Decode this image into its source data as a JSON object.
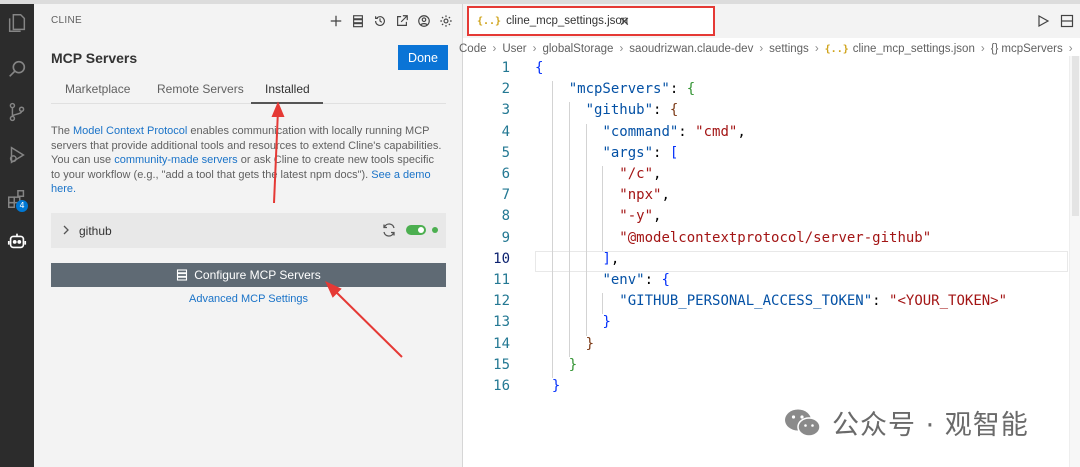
{
  "activity_bar": {
    "extensions_badge": "4",
    "icons": [
      "files-icon",
      "search-icon",
      "source-control-icon",
      "run-debug-icon",
      "extensions-icon",
      "cline-robot-icon"
    ]
  },
  "cline_panel": {
    "title": "CLINE",
    "heading": "MCP Servers",
    "done_label": "Done",
    "tabs": [
      {
        "label": "Marketplace",
        "active": false
      },
      {
        "label": "Remote Servers",
        "active": false
      },
      {
        "label": "Installed",
        "active": true
      }
    ],
    "description": {
      "t1": "The ",
      "link1": "Model Context Protocol",
      "t2": " enables communication with locally running MCP servers that provide additional tools and resources to extend Cline's capabilities. You can use ",
      "link2": "community-made servers",
      "t3": " or ask Cline to create new tools specific to your workflow (e.g., \"add a tool that gets the latest npm docs\"). ",
      "link3": "See a demo here."
    },
    "server": {
      "name": "github",
      "enabled": true,
      "status_color": "#4caf50"
    },
    "configure_label": "Configure MCP Servers",
    "advanced_label": "Advanced MCP Settings"
  },
  "editor": {
    "tab_label": "cline_mcp_settings.json",
    "tab_icon": "{..}",
    "breadcrumb": [
      "Code",
      "User",
      "globalStorage",
      "saoudrizwan.claude-dev",
      "settings",
      "cline_mcp_settings.json",
      "mcpServers",
      "gi"
    ],
    "breadcrumb_icons": {
      "json_file": "{..}",
      "object": "{}"
    },
    "current_line": 10,
    "lines": [
      {
        "n": "1",
        "tokens": [
          {
            "t": "{",
            "c": "b1"
          }
        ]
      },
      {
        "n": "2",
        "tokens": [
          {
            "t": "    ",
            "c": "p"
          },
          {
            "t": "\"mcpServers\"",
            "c": "k"
          },
          {
            "t": ": ",
            "c": "p"
          },
          {
            "t": "{",
            "c": "b2"
          }
        ]
      },
      {
        "n": "3",
        "tokens": [
          {
            "t": "      ",
            "c": "p"
          },
          {
            "t": "\"github\"",
            "c": "k"
          },
          {
            "t": ": ",
            "c": "p"
          },
          {
            "t": "{",
            "c": "b3"
          }
        ]
      },
      {
        "n": "4",
        "tokens": [
          {
            "t": "        ",
            "c": "p"
          },
          {
            "t": "\"command\"",
            "c": "k"
          },
          {
            "t": ": ",
            "c": "p"
          },
          {
            "t": "\"cmd\"",
            "c": "s"
          },
          {
            "t": ",",
            "c": "p"
          }
        ]
      },
      {
        "n": "5",
        "tokens": [
          {
            "t": "        ",
            "c": "p"
          },
          {
            "t": "\"args\"",
            "c": "k"
          },
          {
            "t": ": ",
            "c": "p"
          },
          {
            "t": "[",
            "c": "b1"
          }
        ]
      },
      {
        "n": "6",
        "tokens": [
          {
            "t": "          ",
            "c": "p"
          },
          {
            "t": "\"/c\"",
            "c": "s"
          },
          {
            "t": ",",
            "c": "p"
          }
        ]
      },
      {
        "n": "7",
        "tokens": [
          {
            "t": "          ",
            "c": "p"
          },
          {
            "t": "\"npx\"",
            "c": "s"
          },
          {
            "t": ",",
            "c": "p"
          }
        ]
      },
      {
        "n": "8",
        "tokens": [
          {
            "t": "          ",
            "c": "p"
          },
          {
            "t": "\"-y\"",
            "c": "s"
          },
          {
            "t": ",",
            "c": "p"
          }
        ]
      },
      {
        "n": "9",
        "tokens": [
          {
            "t": "          ",
            "c": "p"
          },
          {
            "t": "\"@modelcontextprotocol/server-github\"",
            "c": "s"
          }
        ]
      },
      {
        "n": "10",
        "tokens": [
          {
            "t": "        ",
            "c": "p"
          },
          {
            "t": "]",
            "c": "b1"
          },
          {
            "t": ",",
            "c": "p"
          }
        ]
      },
      {
        "n": "11",
        "tokens": [
          {
            "t": "        ",
            "c": "p"
          },
          {
            "t": "\"env\"",
            "c": "k"
          },
          {
            "t": ": ",
            "c": "p"
          },
          {
            "t": "{",
            "c": "b1"
          }
        ]
      },
      {
        "n": "12",
        "tokens": [
          {
            "t": "          ",
            "c": "p"
          },
          {
            "t": "\"GITHUB_PERSONAL_ACCESS_TOKEN\"",
            "c": "k"
          },
          {
            "t": ": ",
            "c": "p"
          },
          {
            "t": "\"<YOUR_TOKEN>\"",
            "c": "s"
          }
        ]
      },
      {
        "n": "13",
        "tokens": [
          {
            "t": "        ",
            "c": "p"
          },
          {
            "t": "}",
            "c": "b1"
          }
        ]
      },
      {
        "n": "14",
        "tokens": [
          {
            "t": "      ",
            "c": "p"
          },
          {
            "t": "}",
            "c": "b3"
          }
        ]
      },
      {
        "n": "15",
        "tokens": [
          {
            "t": "    ",
            "c": "p"
          },
          {
            "t": "}",
            "c": "b2"
          }
        ]
      },
      {
        "n": "16",
        "tokens": [
          {
            "t": "  ",
            "c": "p"
          },
          {
            "t": "}",
            "c": "b1"
          }
        ]
      }
    ]
  },
  "watermark": {
    "text": "公众号 · 观智能"
  },
  "colors": {
    "accent": "#0a74d6",
    "annotation_red": "#e53935",
    "toggle_on": "#4caf50"
  }
}
